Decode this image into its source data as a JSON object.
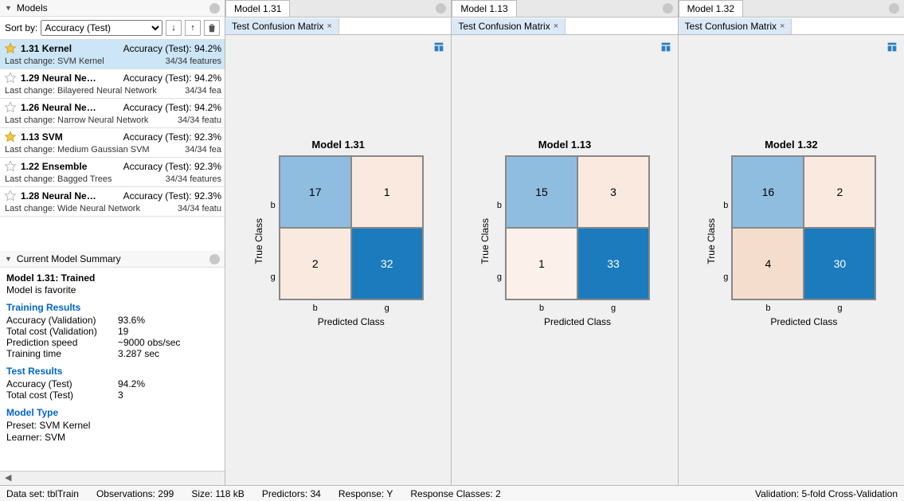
{
  "sidebar": {
    "models_title": "Models",
    "sort_label": "Sort by:",
    "sort_value": "Accuracy (Test)",
    "items": [
      {
        "id": "1.31",
        "name": "Kernel",
        "acc": "Accuracy (Test): 94.2%",
        "lc": "Last change: SVM Kernel",
        "feat": "34/34 features",
        "fav": true,
        "sel": true
      },
      {
        "id": "1.29",
        "name": "Neural Ne…",
        "acc": "Accuracy (Test): 94.2%",
        "lc": "Last change: Bilayered Neural Network",
        "feat": "34/34 fea",
        "fav": false,
        "sel": false
      },
      {
        "id": "1.26",
        "name": "Neural Ne…",
        "acc": "Accuracy (Test): 94.2%",
        "lc": "Last change: Narrow Neural Network",
        "feat": "34/34 featu",
        "fav": false,
        "sel": false
      },
      {
        "id": "1.13",
        "name": "SVM",
        "acc": "Accuracy (Test): 92.3%",
        "lc": "Last change: Medium Gaussian SVM",
        "feat": "34/34 fea",
        "fav": true,
        "sel": false
      },
      {
        "id": "1.22",
        "name": "Ensemble",
        "acc": "Accuracy (Test): 92.3%",
        "lc": "Last change: Bagged Trees",
        "feat": "34/34 features",
        "fav": false,
        "sel": false
      },
      {
        "id": "1.28",
        "name": "Neural Ne…",
        "acc": "Accuracy (Test): 92.3%",
        "lc": "Last change: Wide Neural Network",
        "feat": "34/34 featu",
        "fav": false,
        "sel": false
      }
    ],
    "summary_title": "Current Model Summary",
    "summary": {
      "h1": "Model 1.31: Trained",
      "h2": "Model is favorite",
      "training_title": "Training Results",
      "acc_val_k": "Accuracy (Validation)",
      "acc_val_v": "93.6%",
      "cost_val_k": "Total cost (Validation)",
      "cost_val_v": "19",
      "speed_k": "Prediction speed",
      "speed_v": "~9000 obs/sec",
      "time_k": "Training time",
      "time_v": "3.287 sec",
      "test_title": "Test Results",
      "acc_test_k": "Accuracy (Test)",
      "acc_test_v": "94.2%",
      "cost_test_k": "Total cost (Test)",
      "cost_test_v": "3",
      "type_title": "Model Type",
      "preset": "Preset: SVM Kernel",
      "learner": "Learner: SVM"
    }
  },
  "panes": [
    {
      "tab": "Model 1.31",
      "subtab": "Test Confusion Matrix"
    },
    {
      "tab": "Model 1.13",
      "subtab": "Test Confusion Matrix"
    },
    {
      "tab": "Model 1.32",
      "subtab": "Test Confusion Matrix"
    }
  ],
  "chart_data": [
    {
      "type": "heatmap",
      "title": "Model 1.31",
      "xlabel": "Predicted Class",
      "ylabel": "True Class",
      "row_labels": [
        "b",
        "g"
      ],
      "col_labels": [
        "b",
        "g"
      ],
      "values": [
        [
          17,
          1
        ],
        [
          2,
          32
        ]
      ],
      "colors": [
        [
          "#8fbde0",
          "#f9e9df"
        ],
        [
          "#f9e9df",
          "#1c7bbd"
        ]
      ],
      "text_colors": [
        [
          "#000",
          "#000"
        ],
        [
          "#000",
          "#fff"
        ]
      ]
    },
    {
      "type": "heatmap",
      "title": "Model 1.13",
      "xlabel": "Predicted Class",
      "ylabel": "True Class",
      "row_labels": [
        "b",
        "g"
      ],
      "col_labels": [
        "b",
        "g"
      ],
      "values": [
        [
          15,
          3
        ],
        [
          1,
          33
        ]
      ],
      "colors": [
        [
          "#8fbde0",
          "#f9e9df"
        ],
        [
          "#fcf1ea",
          "#1c7bbd"
        ]
      ],
      "text_colors": [
        [
          "#000",
          "#000"
        ],
        [
          "#000",
          "#fff"
        ]
      ]
    },
    {
      "type": "heatmap",
      "title": "Model 1.32",
      "xlabel": "Predicted Class",
      "ylabel": "True Class",
      "row_labels": [
        "b",
        "g"
      ],
      "col_labels": [
        "b",
        "g"
      ],
      "values": [
        [
          16,
          2
        ],
        [
          4,
          30
        ]
      ],
      "colors": [
        [
          "#8fbde0",
          "#f9e9df"
        ],
        [
          "#f5ddce",
          "#1c7bbd"
        ]
      ],
      "text_colors": [
        [
          "#000",
          "#000"
        ],
        [
          "#000",
          "#fff"
        ]
      ]
    }
  ],
  "status": {
    "dataset": "Data set: tblTrain",
    "obs": "Observations: 299",
    "size": "Size: 118 kB",
    "pred": "Predictors: 34",
    "resp": "Response: Y",
    "classes": "Response Classes: 2",
    "valid": "Validation: 5-fold Cross-Validation"
  }
}
